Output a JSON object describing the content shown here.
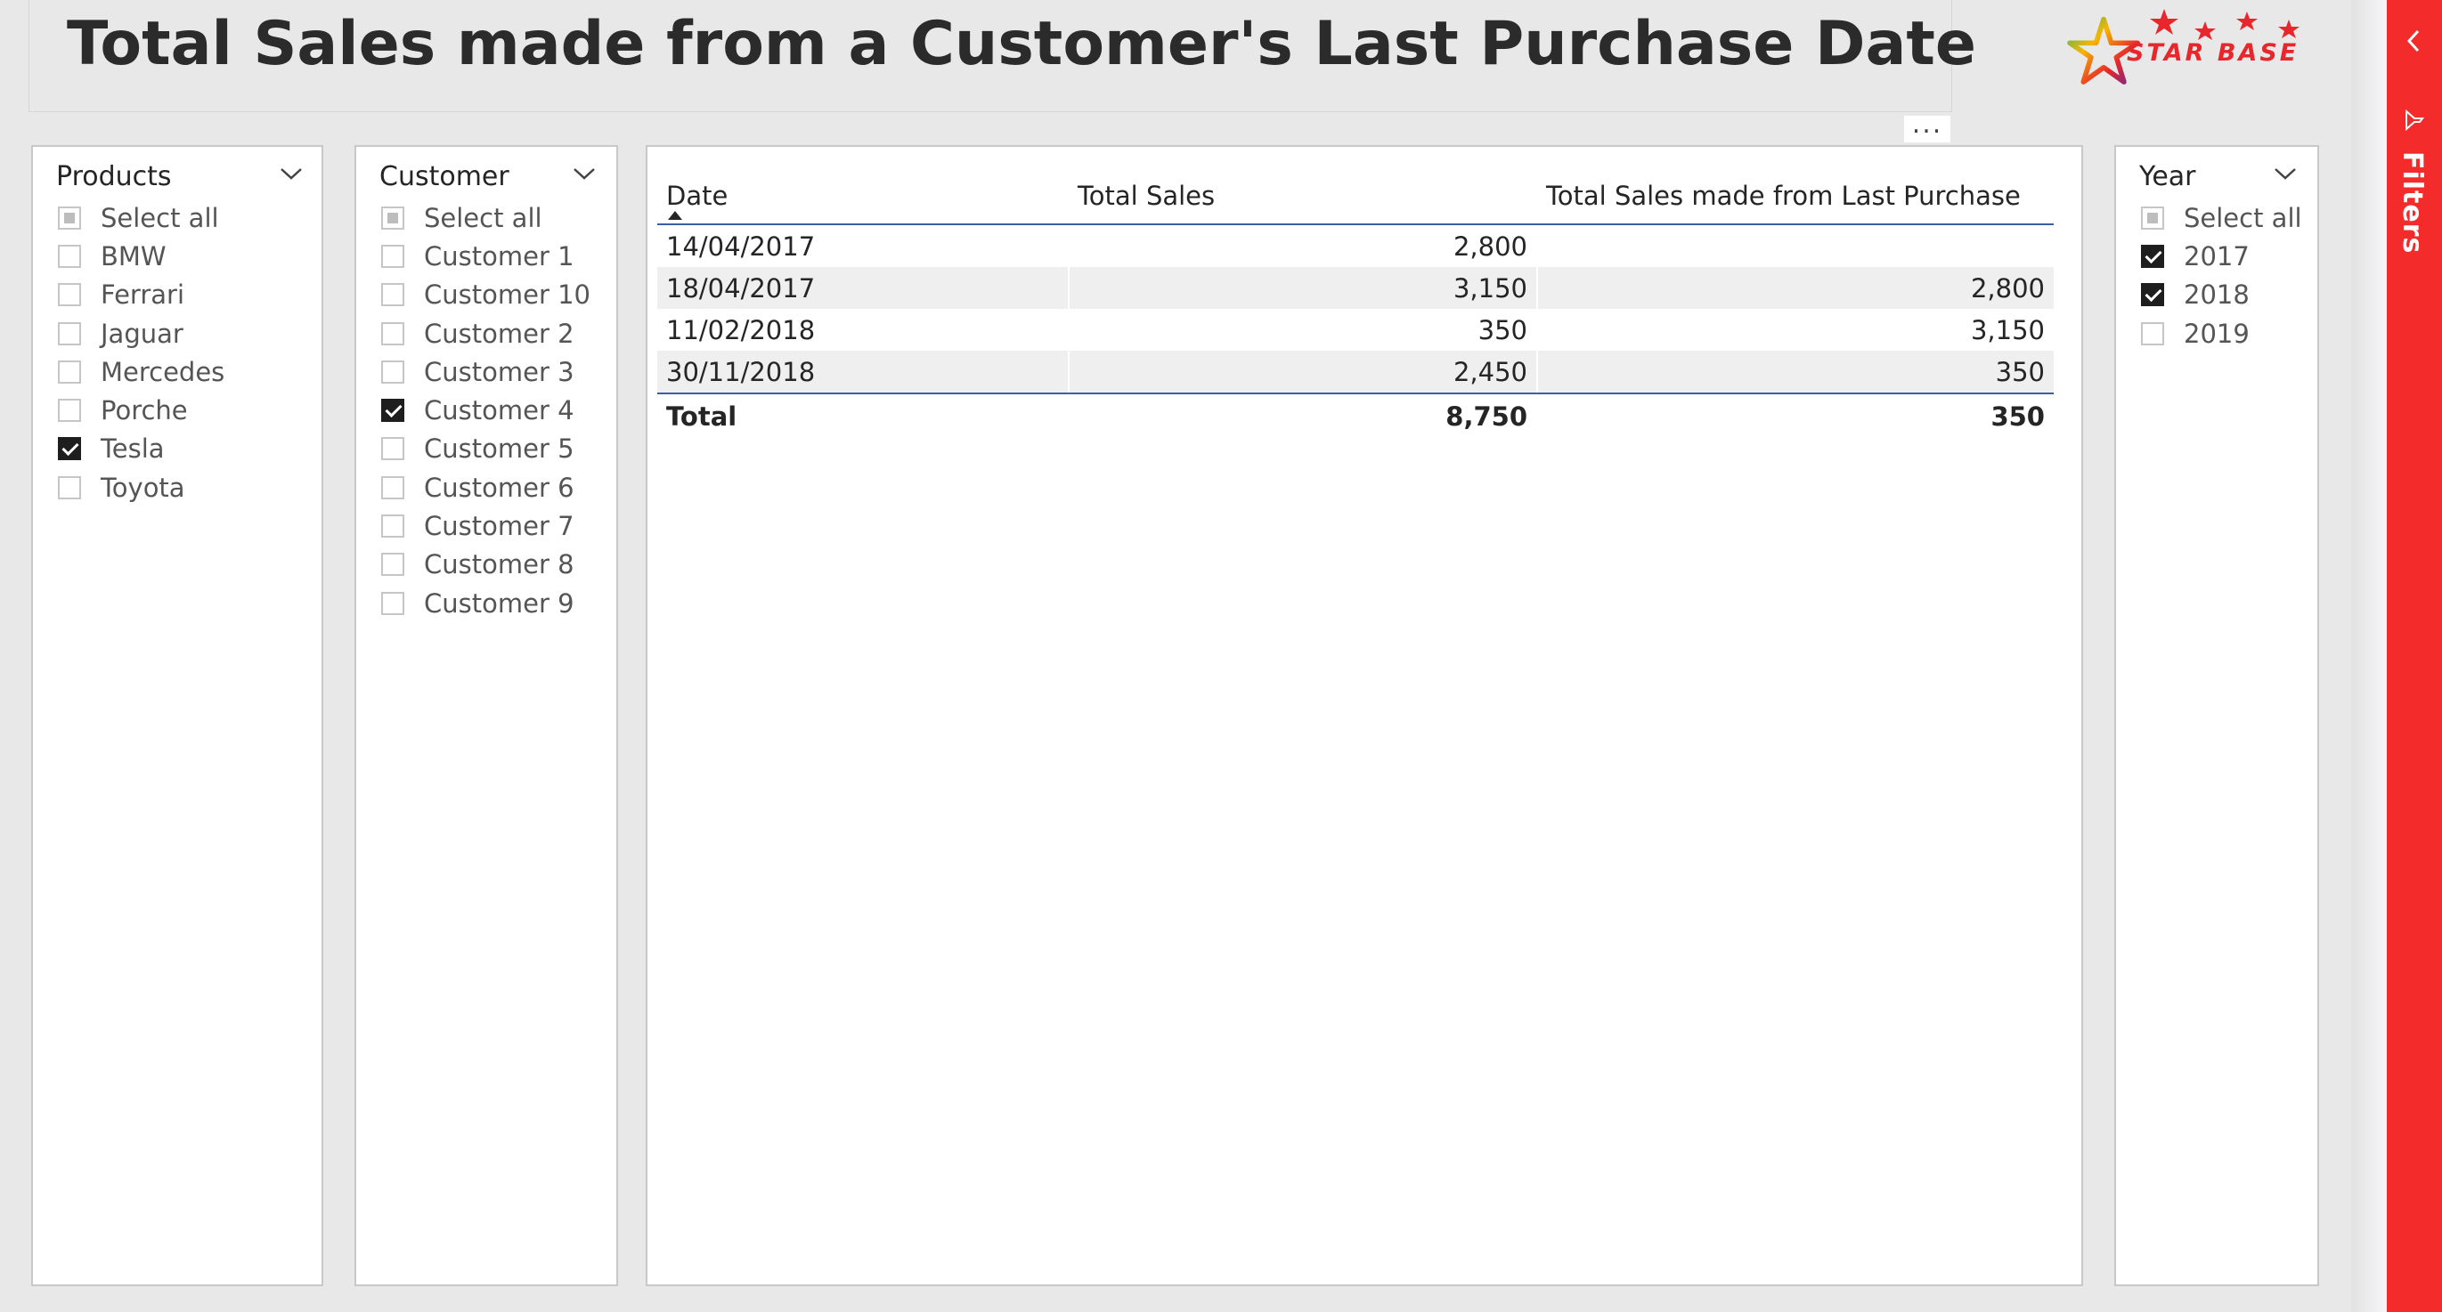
{
  "report": {
    "title": "Total Sales made from a Customer's Last Purchase Date",
    "logo_text": "STAR BASE"
  },
  "accent_colors": {
    "brand_red": "#f32b2b",
    "header_rule": "#3a5fa8",
    "checkbox_checked": "#1e1e1e"
  },
  "slicers": {
    "products": {
      "title": "Products",
      "items": [
        {
          "label": "Select all",
          "state": "partial"
        },
        {
          "label": "BMW",
          "state": "unchecked"
        },
        {
          "label": "Ferrari",
          "state": "unchecked"
        },
        {
          "label": "Jaguar",
          "state": "unchecked"
        },
        {
          "label": "Mercedes",
          "state": "unchecked"
        },
        {
          "label": "Porche",
          "state": "unchecked"
        },
        {
          "label": "Tesla",
          "state": "checked"
        },
        {
          "label": "Toyota",
          "state": "unchecked"
        }
      ]
    },
    "customer": {
      "title": "Customer",
      "items": [
        {
          "label": "Select all",
          "state": "partial"
        },
        {
          "label": "Customer 1",
          "state": "unchecked"
        },
        {
          "label": "Customer 10",
          "state": "unchecked"
        },
        {
          "label": "Customer 2",
          "state": "unchecked"
        },
        {
          "label": "Customer 3",
          "state": "unchecked"
        },
        {
          "label": "Customer 4",
          "state": "checked"
        },
        {
          "label": "Customer 5",
          "state": "unchecked"
        },
        {
          "label": "Customer 6",
          "state": "unchecked"
        },
        {
          "label": "Customer 7",
          "state": "unchecked"
        },
        {
          "label": "Customer 8",
          "state": "unchecked"
        },
        {
          "label": "Customer 9",
          "state": "unchecked"
        }
      ]
    },
    "year": {
      "title": "Year",
      "items": [
        {
          "label": "Select all",
          "state": "partial"
        },
        {
          "label": "2017",
          "state": "checked"
        },
        {
          "label": "2018",
          "state": "checked"
        },
        {
          "label": "2019",
          "state": "unchecked"
        }
      ]
    }
  },
  "table": {
    "more_options": "...",
    "columns": [
      "Date",
      "Total Sales",
      "Total Sales made from Last Purchase"
    ],
    "sorted_column": "Date",
    "sort_direction": "ascending",
    "rows": [
      [
        "14/04/2017",
        "2,800",
        ""
      ],
      [
        "18/04/2017",
        "3,150",
        "2,800"
      ],
      [
        "11/02/2018",
        "350",
        "3,150"
      ],
      [
        "30/11/2018",
        "2,450",
        "350"
      ]
    ],
    "total": [
      "Total",
      "8,750",
      "350"
    ]
  },
  "filter_pane": {
    "label": "Filters",
    "collapse_icon": "chevron-left-icon",
    "filter_icon": "funnel-icon"
  }
}
